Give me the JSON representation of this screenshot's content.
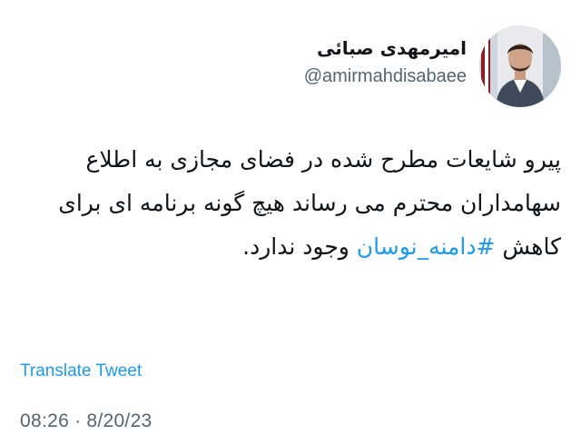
{
  "author": {
    "display_name": "امیرمهدی صبائی",
    "handle": "@amirmahdisabaee"
  },
  "tweet": {
    "text_before_hashtag": "پیرو شایعات مطرح شده در فضای مجازی به اطلاع سهامداران محترم می رساند هیچ گونه برنامه ای برای کاهش ",
    "hashtag": "#دامنه_نوسان",
    "text_after_hashtag": " وجود ندارد."
  },
  "translate_label": "Translate Tweet",
  "timestamp": {
    "time": "08:26",
    "separator": "·",
    "date": "8/20/23"
  },
  "icons": {
    "logo": "twitter-bird-icon"
  },
  "colors": {
    "link": "#1d9bf0",
    "text": "#0f1419",
    "muted": "#536471"
  }
}
